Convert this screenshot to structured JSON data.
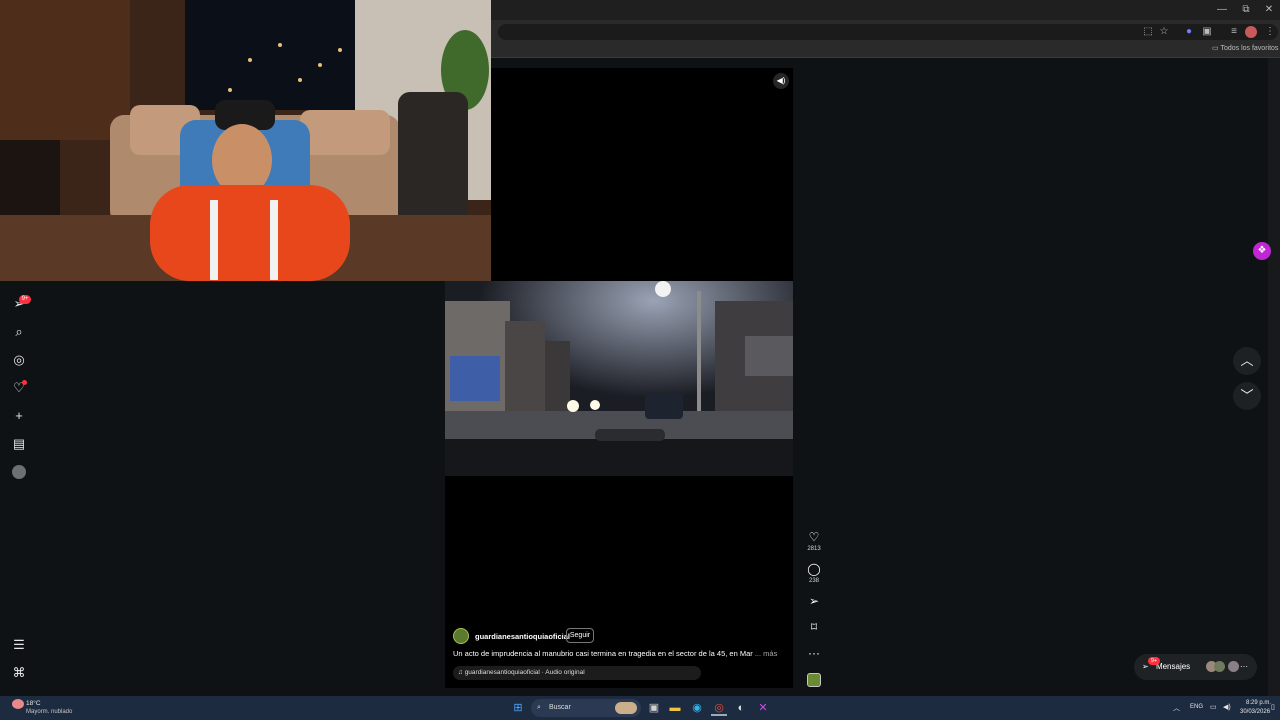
{
  "browser": {
    "window_controls": {
      "minimize": "—",
      "maximize": "⧉",
      "close": "✕"
    },
    "bookmarks_label": "Todos los favoritos"
  },
  "instagram": {
    "nav_badge": "9+",
    "post": {
      "author": "guardianesantioquiaoficial",
      "follow_label": "Seguir",
      "caption": "Un acto de imprudencia al manubrio casi termina en tragedia en el sector de la 45, en Mar",
      "more_label": "... más",
      "audio": "guardianesantioquiaoficial · Audio original",
      "likes": "2813",
      "comments": "238"
    },
    "messages": {
      "label": "Mensajes",
      "badge": "9+"
    }
  },
  "taskbar": {
    "weather_temp": "18°C",
    "weather_desc": "Mayorm. nublado",
    "search_placeholder": "Buscar",
    "lang": "ENG",
    "time": "8:29 p.m.",
    "date": "30/03/2026"
  },
  "colors": {
    "accent_badge": "#ff3040",
    "extension": "#c026d3",
    "taskbar": "#1d2b40"
  }
}
